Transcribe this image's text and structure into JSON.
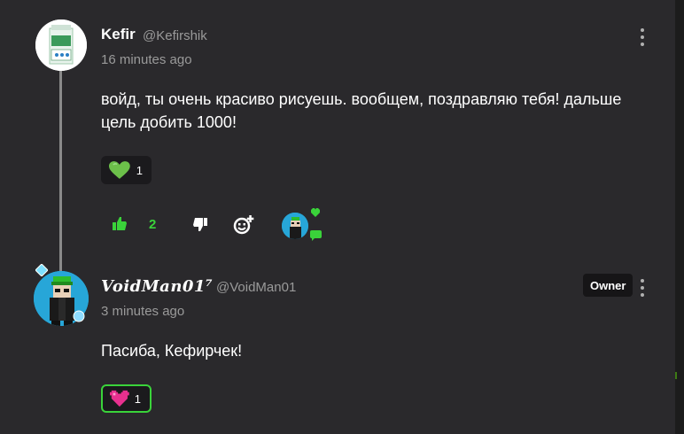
{
  "colors": {
    "card_bg": "#2a292c",
    "accent_green": "#3ad33a",
    "muted_text": "#9a9a9a",
    "page_bg": "#1c1c1c"
  },
  "comments": [
    {
      "author": "Kefir",
      "handle": "@Kefirshik",
      "time": "16 minutes ago",
      "text": "войд, ты очень красиво рисуешь. вообщем, поздравляю тебя! дальше цель добить 1000!",
      "reaction": {
        "icon": "green-heart-icon",
        "count": "1"
      },
      "actions": {
        "like_count": "2",
        "like_icon": "thumbs-up-icon",
        "dislike_icon": "thumbs-down-icon",
        "emoji_icon": "add-reaction-icon",
        "creator_heart_icon": "heart-icon",
        "reply_icon": "comment-icon"
      }
    },
    {
      "author": "VoidMan01⁷",
      "handle": "@VoidMan01",
      "badge": "Owner",
      "time": "3 minutes ago",
      "text": "Пасиба, Кефирчек!",
      "reaction": {
        "icon": "pink-heart-icon",
        "count": "1"
      }
    }
  ]
}
